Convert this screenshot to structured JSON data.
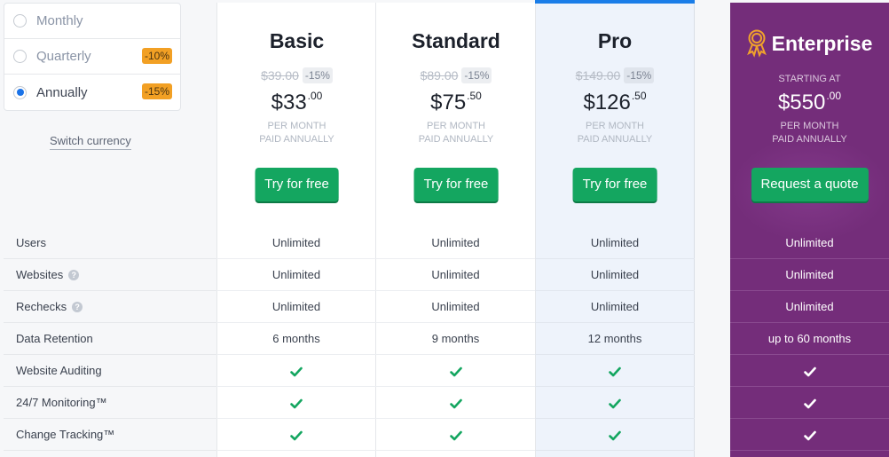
{
  "billing": {
    "options": [
      {
        "label": "Monthly",
        "discount": null,
        "selected": false
      },
      {
        "label": "Quarterly",
        "discount": "-10%",
        "selected": false
      },
      {
        "label": "Annually",
        "discount": "-15%",
        "selected": true
      }
    ],
    "switch_currency": "Switch currency"
  },
  "plans": [
    {
      "name": "Basic",
      "old_price": "$39.00",
      "discount": "-15%",
      "price_main": "$33",
      "price_cents": ".00",
      "note1": "PER MONTH",
      "note2": "PAID ANNUALLY",
      "cta": "Try for free"
    },
    {
      "name": "Standard",
      "old_price": "$89.00",
      "discount": "-15%",
      "price_main": "$75",
      "price_cents": ".50",
      "note1": "PER MONTH",
      "note2": "PAID ANNUALLY",
      "cta": "Try for free"
    },
    {
      "name": "Pro",
      "old_price": "$149.00",
      "discount": "-15%",
      "price_main": "$126",
      "price_cents": ".50",
      "note1": "PER MONTH",
      "note2": "PAID ANNUALLY",
      "cta": "Try for free",
      "highlighted": true
    },
    {
      "name": "Enterprise",
      "icon": "award-ribbon-icon",
      "starting_at": "STARTING AT",
      "price_main": "$550",
      "price_cents": ".00",
      "note1": "PER MONTH",
      "note2": "PAID ANNUALLY",
      "cta": "Request a quote"
    }
  ],
  "features": [
    {
      "label": "Users",
      "help": false,
      "values": [
        "Unlimited",
        "Unlimited",
        "Unlimited",
        "Unlimited"
      ]
    },
    {
      "label": "Websites",
      "help": true,
      "values": [
        "Unlimited",
        "Unlimited",
        "Unlimited",
        "Unlimited"
      ]
    },
    {
      "label": "Rechecks",
      "help": true,
      "values": [
        "Unlimited",
        "Unlimited",
        "Unlimited",
        "Unlimited"
      ]
    },
    {
      "label": "Data Retention",
      "help": false,
      "values": [
        "6 months",
        "9 months",
        "12 months",
        "up to 60 months"
      ]
    },
    {
      "label": "Website Auditing",
      "help": false,
      "values": [
        "check",
        "check",
        "check",
        "check"
      ]
    },
    {
      "label": "24/7 Monitoring™",
      "help": false,
      "values": [
        "check",
        "check",
        "check",
        "check"
      ]
    },
    {
      "label": "Change Tracking™",
      "help": false,
      "values": [
        "check",
        "check",
        "check",
        "check"
      ]
    }
  ],
  "colors": {
    "accent_blue": "#1a7de8",
    "cta_green": "#14a660",
    "discount_orange": "#f2a024",
    "enterprise_purple": "#742d7a",
    "check_green": "#14a660"
  }
}
